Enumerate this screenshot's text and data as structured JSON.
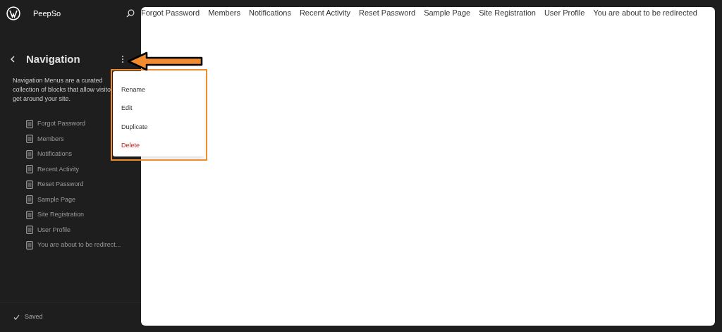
{
  "site": {
    "name": "PeepSo"
  },
  "panel": {
    "title": "Navigation",
    "description_lines": [
      "Navigation Menus are a curated",
      "collection of blocks that allow visito",
      "get around your site."
    ],
    "items": [
      {
        "label": "Forgot Password"
      },
      {
        "label": "Members"
      },
      {
        "label": "Notifications"
      },
      {
        "label": "Recent Activity"
      },
      {
        "label": "Reset Password"
      },
      {
        "label": "Sample Page"
      },
      {
        "label": "Site Registration"
      },
      {
        "label": "User Profile"
      },
      {
        "label": "You are about to be redirect..."
      }
    ]
  },
  "menu": [
    {
      "label": "Rename",
      "kind": "normal"
    },
    {
      "label": "Edit",
      "kind": "normal"
    },
    {
      "label": "Duplicate",
      "kind": "normal"
    },
    {
      "label": "Delete",
      "kind": "destructive"
    }
  ],
  "preview": {
    "links": [
      "Forgot Password",
      "Members",
      "Notifications",
      "Recent Activity",
      "Reset Password",
      "Sample Page",
      "Site Registration",
      "User Profile",
      "You are about to be redirected"
    ]
  },
  "status": "Saved"
}
